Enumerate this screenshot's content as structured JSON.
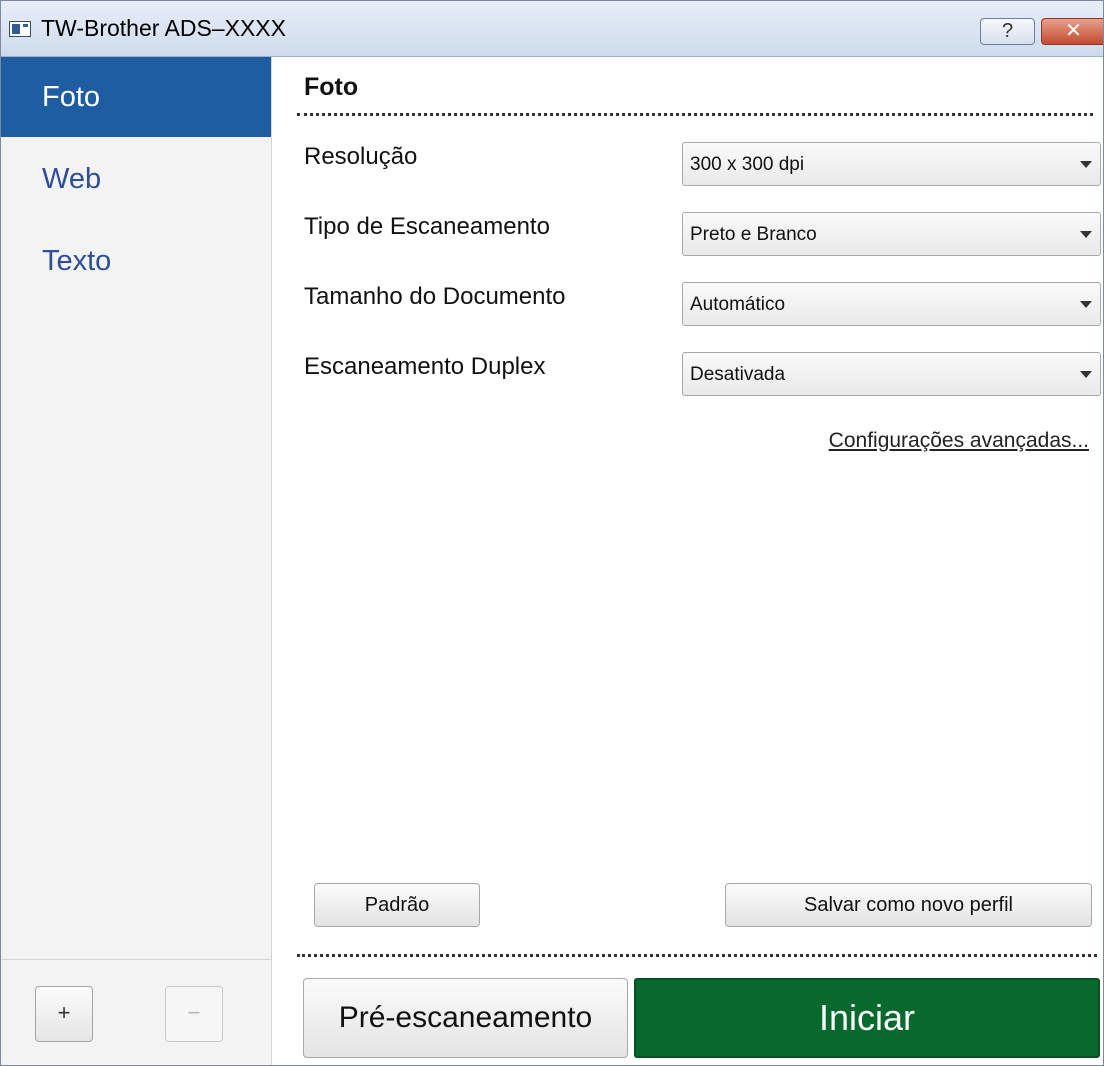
{
  "window": {
    "title": "TW-Brother  ADS–XXXX",
    "help_label": "?",
    "close_label": "✕"
  },
  "sidebar": {
    "items": [
      {
        "label": "Foto",
        "active": true
      },
      {
        "label": "Web",
        "active": false
      },
      {
        "label": "Texto",
        "active": false
      }
    ],
    "add_label": "+",
    "remove_label": "−"
  },
  "main": {
    "section_title": "Foto",
    "fields": [
      {
        "label": "Resolução",
        "value": "300 x 300 dpi"
      },
      {
        "label": "Tipo de Escaneamento",
        "value": "Preto e Branco"
      },
      {
        "label": "Tamanho do Documento",
        "value": "Automático"
      },
      {
        "label": "Escaneamento Duplex",
        "value": "Desativada"
      }
    ],
    "advanced_link": "Configurações avançadas...",
    "default_button": "Padrão",
    "save_profile_button": "Salvar como novo perfil",
    "prescan_button": "Pré-escaneamento",
    "start_button": "Iniciar"
  },
  "colors": {
    "active_tab": "#1e5da2",
    "sidebar_link": "#2d4f9a",
    "start_button": "#08692f"
  }
}
